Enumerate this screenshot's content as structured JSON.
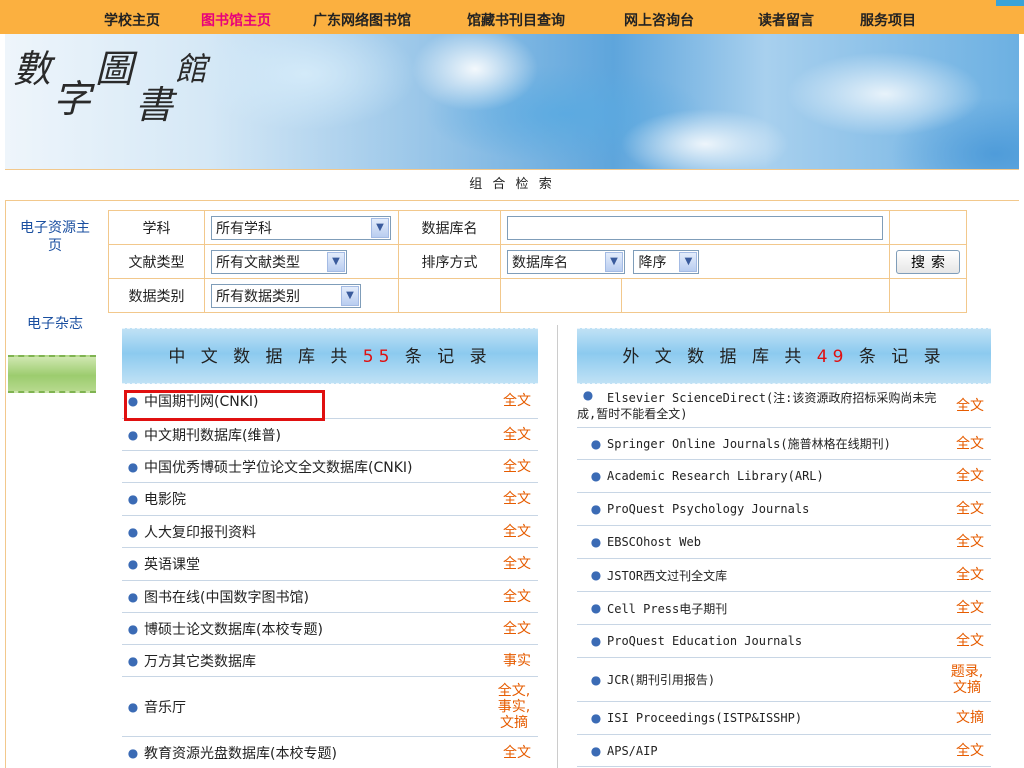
{
  "topnav": {
    "items": [
      "学校主页",
      "图书馆主页",
      "广东网络图书馆",
      "馆藏书刊目查询",
      "网上咨询台",
      "读者留言",
      "服务项目"
    ],
    "active_index": 1
  },
  "banner": {
    "calligraphy": [
      "數",
      "字",
      "圖",
      "書",
      "館"
    ]
  },
  "combo_search": {
    "title": "组 合 检 索"
  },
  "sidebar": {
    "items": [
      "电子资源主页",
      "电子杂志"
    ]
  },
  "search_form": {
    "subject_label": "学科",
    "subject_value": "所有学科",
    "dbname_label": "数据库名",
    "dbname_value": "",
    "doctype_label": "文献类型",
    "doctype_value": "所有文献类型",
    "sort_label": "排序方式",
    "sort_field_value": "数据库名",
    "sort_order_value": "降序",
    "search_button": "搜索",
    "category_label": "数据类别",
    "category_value": "所有数据类别"
  },
  "chinese_db": {
    "header_prefix": "中 文 数 据 库 共 ",
    "count": "55",
    "header_suffix": " 条 记 录",
    "rows": [
      {
        "name": "中国期刊网(CNKI)",
        "type": "全文"
      },
      {
        "name": "中文期刊数据库(维普)",
        "type": "全文"
      },
      {
        "name": "中国优秀博硕士学位论文全文数据库(CNKI)",
        "type": "全文"
      },
      {
        "name": "电影院",
        "type": "全文"
      },
      {
        "name": "人大复印报刊资料",
        "type": "全文"
      },
      {
        "name": "英语课堂",
        "type": "全文"
      },
      {
        "name": "图书在线(中国数字图书馆)",
        "type": "全文"
      },
      {
        "name": "博硕士论文数据库(本校专题)",
        "type": "全文"
      },
      {
        "name": "万方其它类数据库",
        "type": "事实"
      },
      {
        "name": "音乐厅",
        "type": "全文,事实,文摘"
      },
      {
        "name": "教育资源光盘数据库(本校专题)",
        "type": "全文"
      }
    ]
  },
  "foreign_db": {
    "header_prefix": "外 文 数 据 库 共 ",
    "count": "49",
    "header_suffix": " 条 记 录",
    "rows": [
      {
        "name": "Elsevier ScienceDirect(注:该资源政府招标采购尚未完成,暂时不能看全文)",
        "type": "全文"
      },
      {
        "name": "Springer Online Journals(施普林格在线期刊)",
        "type": "全文"
      },
      {
        "name": "Academic Research Library(ARL)",
        "type": "全文"
      },
      {
        "name": "ProQuest Psychology Journals",
        "type": "全文"
      },
      {
        "name": "EBSCOhost Web",
        "type": "全文"
      },
      {
        "name": "JSTOR西文过刊全文库",
        "type": "全文"
      },
      {
        "name": "Cell Press电子期刊",
        "type": "全文"
      },
      {
        "name": "ProQuest Education Journals",
        "type": "全文"
      },
      {
        "name": "JCR(期刊引用报告)",
        "type": "题录,文摘"
      },
      {
        "name": "ISI Proceedings(ISTP&ISSHP)",
        "type": "文摘"
      },
      {
        "name": "APS/AIP",
        "type": "全文"
      }
    ]
  },
  "colors": {
    "nav_bg": "#fbb040",
    "nav_active": "#e8007a",
    "link_blue": "#1a4fa0",
    "type_orange": "#e65c00",
    "count_red": "#e01010",
    "highlight": "#e01010"
  }
}
